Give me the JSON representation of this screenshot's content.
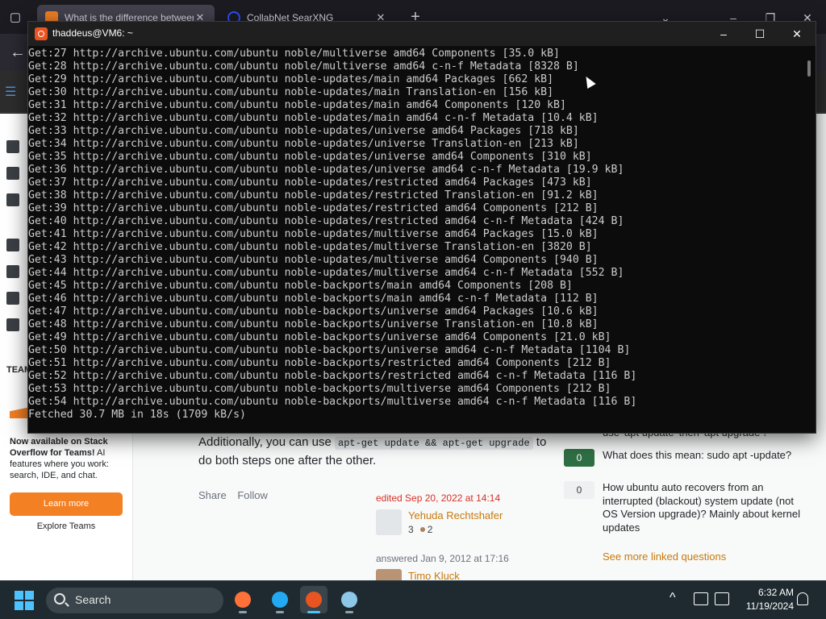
{
  "browser": {
    "tabs": [
      {
        "label": "What is the difference between"
      },
      {
        "label": "CollabNet SearXNG"
      }
    ],
    "tab_close_glyph": "✕",
    "new_tab_glyph": "+",
    "tab_list_glyph": "⌄",
    "minimize_glyph": "–",
    "restore_glyph": "❐",
    "close_glyph": "✕",
    "back_glyph": "←"
  },
  "so_page": {
    "teams_label": "TEAM",
    "promo_bold": "Now available on Stack Overflow for Teams!",
    "promo_text": " AI features where you work: search, IDE, and chat.",
    "learn_more": "Learn more",
    "explore_teams": "Explore Teams",
    "answer_prefix": "Additionally, you can use ",
    "answer_code": "apt-get update && apt-get upgrade",
    "answer_suffix": " to do both steps one after the other.",
    "share": "Share",
    "follow": "Follow",
    "edited": "edited Sep 20, 2022 at 14:14",
    "editor_name": "Yehuda Rechtshafer",
    "editor_rep": "3",
    "editor_bronze": "2",
    "answered": "answered Jan 9, 2012 at 17:16",
    "answerer_name": "Timo Kluck",
    "linked_questions": [
      {
        "score": "0",
        "title": "What does this mean: sudo apt -update?",
        "accepted": true
      },
      {
        "score": "0",
        "title": "How ubuntu auto recovers from an interrupted (blackout) system update (not OS Version upgrade)? Mainly about kernel updates",
        "accepted": false
      }
    ],
    "partial_title": "use 'apt update' then 'apt upgrade'?",
    "see_more": "See more linked questions"
  },
  "terminal": {
    "title": "thaddeus@VM6: ~",
    "lines": [
      "Get:27 http://archive.ubuntu.com/ubuntu noble/multiverse amd64 Components [35.0 kB]",
      "Get:28 http://archive.ubuntu.com/ubuntu noble/multiverse amd64 c-n-f Metadata [8328 B]",
      "Get:29 http://archive.ubuntu.com/ubuntu noble-updates/main amd64 Packages [662 kB]",
      "Get:30 http://archive.ubuntu.com/ubuntu noble-updates/main Translation-en [156 kB]",
      "Get:31 http://archive.ubuntu.com/ubuntu noble-updates/main amd64 Components [120 kB]",
      "Get:32 http://archive.ubuntu.com/ubuntu noble-updates/main amd64 c-n-f Metadata [10.4 kB]",
      "Get:33 http://archive.ubuntu.com/ubuntu noble-updates/universe amd64 Packages [718 kB]",
      "Get:34 http://archive.ubuntu.com/ubuntu noble-updates/universe Translation-en [213 kB]",
      "Get:35 http://archive.ubuntu.com/ubuntu noble-updates/universe amd64 Components [310 kB]",
      "Get:36 http://archive.ubuntu.com/ubuntu noble-updates/universe amd64 c-n-f Metadata [19.9 kB]",
      "Get:37 http://archive.ubuntu.com/ubuntu noble-updates/restricted amd64 Packages [473 kB]",
      "Get:38 http://archive.ubuntu.com/ubuntu noble-updates/restricted Translation-en [91.2 kB]",
      "Get:39 http://archive.ubuntu.com/ubuntu noble-updates/restricted amd64 Components [212 B]",
      "Get:40 http://archive.ubuntu.com/ubuntu noble-updates/restricted amd64 c-n-f Metadata [424 B]",
      "Get:41 http://archive.ubuntu.com/ubuntu noble-updates/multiverse amd64 Packages [15.0 kB]",
      "Get:42 http://archive.ubuntu.com/ubuntu noble-updates/multiverse Translation-en [3820 B]",
      "Get:43 http://archive.ubuntu.com/ubuntu noble-updates/multiverse amd64 Components [940 B]",
      "Get:44 http://archive.ubuntu.com/ubuntu noble-updates/multiverse amd64 c-n-f Metadata [552 B]",
      "Get:45 http://archive.ubuntu.com/ubuntu noble-backports/main amd64 Components [208 B]",
      "Get:46 http://archive.ubuntu.com/ubuntu noble-backports/main amd64 c-n-f Metadata [112 B]",
      "Get:47 http://archive.ubuntu.com/ubuntu noble-backports/universe amd64 Packages [10.6 kB]",
      "Get:48 http://archive.ubuntu.com/ubuntu noble-backports/universe Translation-en [10.8 kB]",
      "Get:49 http://archive.ubuntu.com/ubuntu noble-backports/universe amd64 Components [21.0 kB]",
      "Get:50 http://archive.ubuntu.com/ubuntu noble-backports/universe amd64 c-n-f Metadata [1104 B]",
      "Get:51 http://archive.ubuntu.com/ubuntu noble-backports/restricted amd64 Components [212 B]",
      "Get:52 http://archive.ubuntu.com/ubuntu noble-backports/restricted amd64 c-n-f Metadata [116 B]",
      "Get:53 http://archive.ubuntu.com/ubuntu noble-backports/multiverse amd64 Components [212 B]",
      "Get:54 http://archive.ubuntu.com/ubuntu noble-backports/multiverse amd64 c-n-f Metadata [116 B]",
      "Fetched 30.7 MB in 18s (1709 kB/s)"
    ]
  },
  "taskbar": {
    "search_label": "Search",
    "time": "6:32 AM",
    "date": "11/19/2024",
    "apps": [
      {
        "icon": "firefox-icon",
        "color": "#ff7139",
        "active": false
      },
      {
        "icon": "vscode-icon",
        "color": "#23a9f2",
        "active": false
      },
      {
        "icon": "ubuntu-icon",
        "color": "#e95420",
        "active": true
      },
      {
        "icon": "notepad-icon",
        "color": "#8ec8e8",
        "active": false
      }
    ],
    "tray_chevron": "^"
  },
  "colors": {
    "terminal_bg": "#0c0c0c",
    "terminal_text": "#cccccc",
    "so_orange": "#f48024",
    "accepted_green": "#2f6f44"
  }
}
